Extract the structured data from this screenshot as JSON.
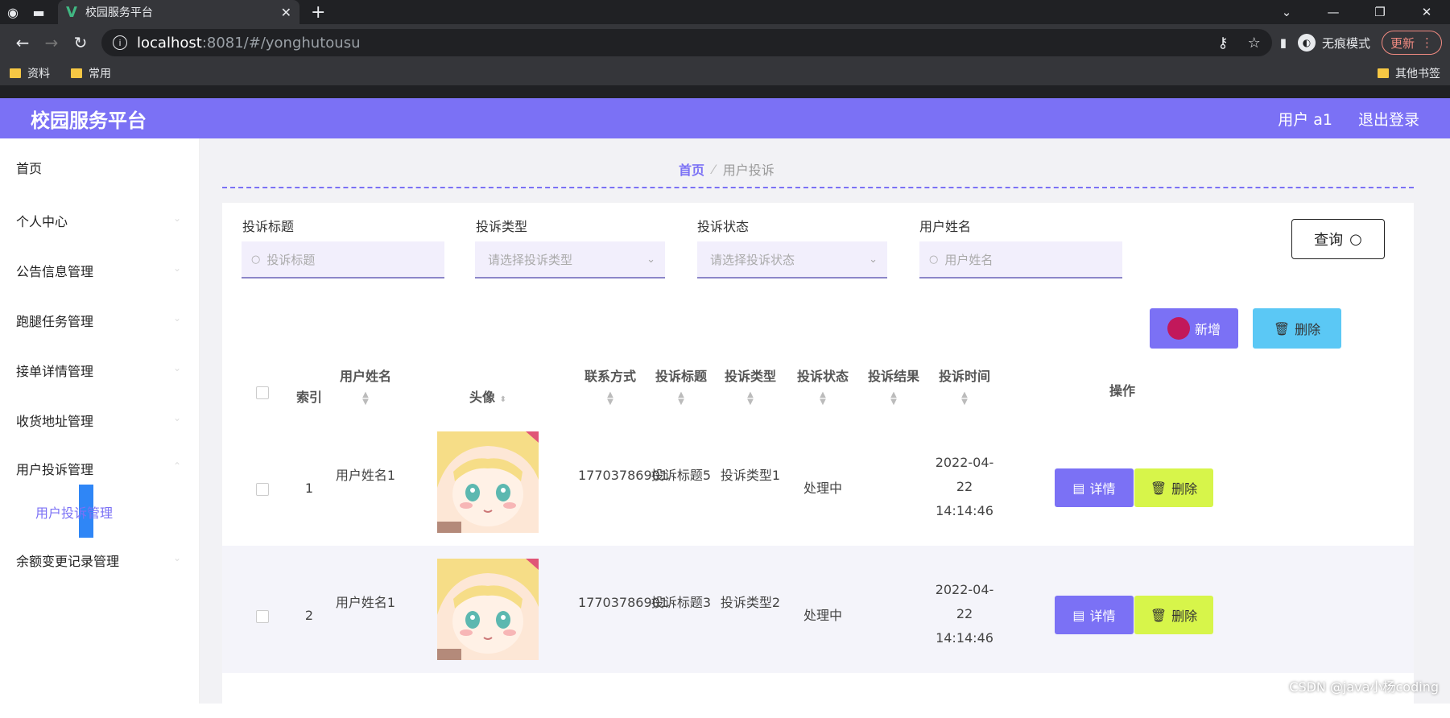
{
  "browser": {
    "tab_title": "校园服务平台",
    "url_host": "localhost",
    "url_path": ":8081/#/yonghutousu",
    "incognito_label": "无痕模式",
    "update_label": "更新",
    "bookmarks": [
      "资料",
      "常用"
    ],
    "other_bookmarks": "其他书签"
  },
  "app": {
    "brand": "校园服务平台",
    "user_label": "用户 a1",
    "logout_label": "退出登录"
  },
  "sidebar": {
    "items": [
      "首页",
      "个人中心",
      "公告信息管理",
      "跑腿任务管理",
      "接单详情管理",
      "收货地址管理",
      "用户投诉管理",
      "余额变更记录管理"
    ],
    "submenu_active": "用户投诉管理"
  },
  "breadcrumb": {
    "home": "首页",
    "current": "用户投诉"
  },
  "filters": {
    "title_label": "投诉标题",
    "title_placeholder": "投诉标题",
    "type_label": "投诉类型",
    "type_placeholder": "请选择投诉类型",
    "status_label": "投诉状态",
    "status_placeholder": "请选择投诉状态",
    "username_label": "用户姓名",
    "username_placeholder": "用户姓名",
    "query_label": "查询"
  },
  "actions": {
    "add_label": "新增",
    "delete_label": "删除"
  },
  "table": {
    "headers": {
      "index": "索引",
      "username": "用户姓名",
      "avatar": "头像",
      "contact": "联系方式",
      "title": "投诉标题",
      "type": "投诉类型",
      "status": "投诉状态",
      "result": "投诉结果",
      "time": "投诉时间",
      "ops": "操作"
    },
    "detail_label": "详情",
    "delete_label": "删除",
    "rows": [
      {
        "index": "1",
        "username": "用户姓名1",
        "contact": "17703786901",
        "title": "投诉标题5",
        "type": "投诉类型1",
        "status": "处理中",
        "result": "",
        "time": "2022-04-22 14:14:46"
      },
      {
        "index": "2",
        "username": "用户姓名1",
        "contact": "17703786901",
        "title": "投诉标题3",
        "type": "投诉类型2",
        "status": "处理中",
        "result": "",
        "time": "2022-04-22 14:14:46"
      }
    ]
  },
  "watermark": "CSDN @java小杨coding",
  "colors": {
    "primary": "#7b71f5",
    "delete_top": "#5bc8f5",
    "delete_row": "#d7f54a"
  }
}
